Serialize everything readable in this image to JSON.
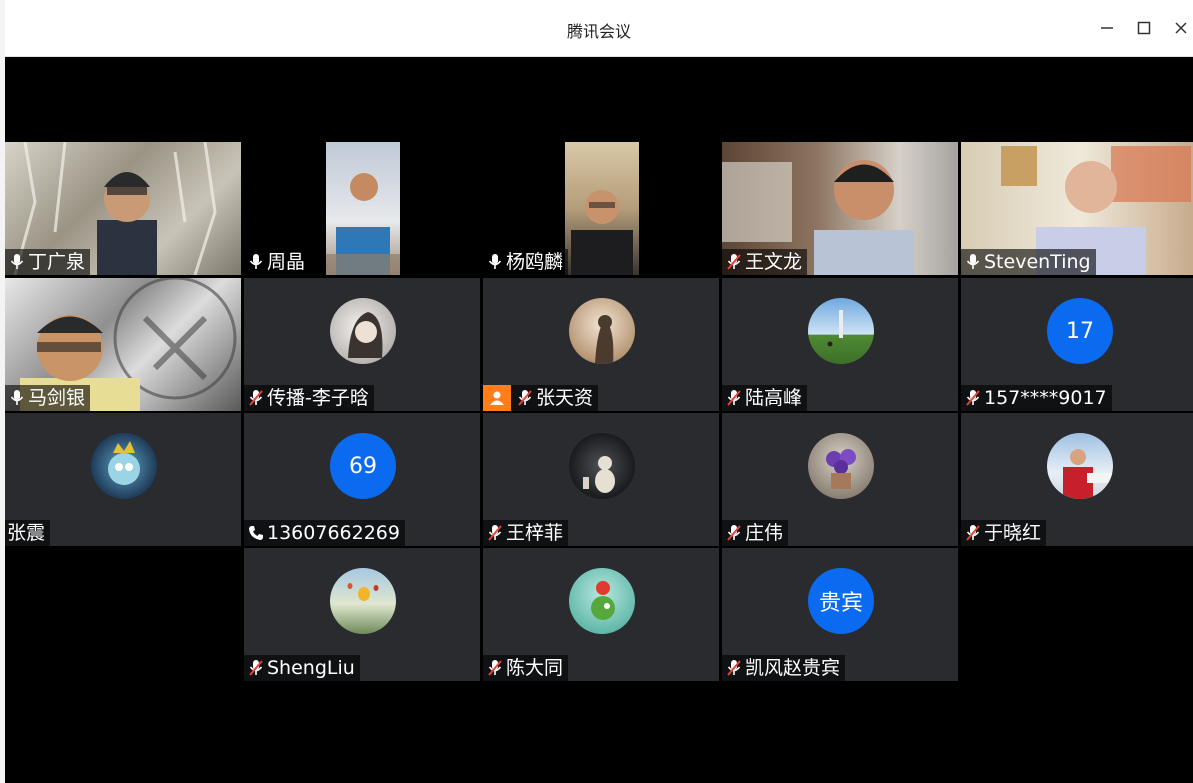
{
  "window": {
    "title": "腾讯会议",
    "minimize_icon": "minimize-icon",
    "maximize_icon": "maximize-icon",
    "close_icon": "close-icon"
  },
  "participants": [
    {
      "name": "丁广泉",
      "status": "mic-on",
      "view": "video"
    },
    {
      "name": "周晶",
      "status": "mic-on",
      "view": "video"
    },
    {
      "name": "杨鸥麟",
      "status": "mic-on",
      "view": "video"
    },
    {
      "name": "王文龙",
      "status": "mic-muted",
      "view": "video"
    },
    {
      "name": "StevenTing",
      "status": "mic-on",
      "view": "video"
    },
    {
      "name": "马剑银",
      "status": "mic-on",
      "view": "video"
    },
    {
      "name": "传播-李子晗",
      "status": "mic-muted",
      "view": "avatar-photo"
    },
    {
      "name": "张天资",
      "status": "mic-muted",
      "view": "avatar-photo",
      "sharing": true
    },
    {
      "name": "陆高峰",
      "status": "mic-muted",
      "view": "avatar-photo"
    },
    {
      "name": "157****9017",
      "status": "mic-muted",
      "view": "avatar-text",
      "avatar_text": "17"
    },
    {
      "name": "张震",
      "status": "none",
      "view": "avatar-photo"
    },
    {
      "name": "13607662269",
      "status": "phone",
      "view": "avatar-text",
      "avatar_text": "69"
    },
    {
      "name": "王梓菲",
      "status": "mic-muted",
      "view": "avatar-photo"
    },
    {
      "name": "庄伟",
      "status": "mic-muted",
      "view": "avatar-photo"
    },
    {
      "name": "于晓红",
      "status": "mic-muted",
      "view": "avatar-photo"
    },
    {
      "name": "ShengLiu",
      "status": "mic-muted",
      "view": "avatar-photo"
    },
    {
      "name": "陈大同",
      "status": "mic-muted",
      "view": "avatar-photo"
    },
    {
      "name": "凯风赵贵宾",
      "status": "mic-muted",
      "view": "avatar-text",
      "avatar_text": "贵宾"
    }
  ],
  "colors": {
    "tile_bg": "#2a2b2f",
    "avatar_blue": "#0b6bf0",
    "active_speaker": "#2e9b4e",
    "share_orange": "#ff7d1a",
    "muted_red": "#e8413c"
  }
}
